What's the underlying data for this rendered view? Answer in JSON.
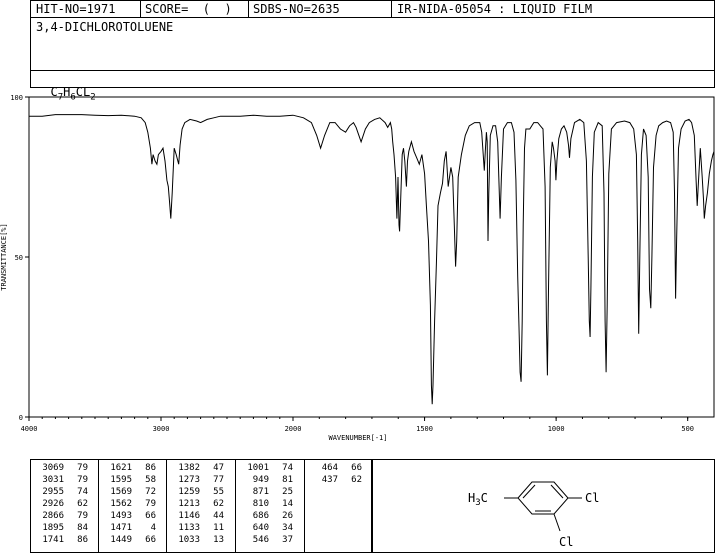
{
  "header": {
    "hit_no": "HIT-NO=1971",
    "score": "SCORE=  (  )",
    "sdbs_no": "SDBS-NO=2635",
    "ir_nida": "IR-NIDA-05054 : LIQUID FILM",
    "compound_name": "3,4-DICHLOROTOLUENE",
    "formula": {
      "c": "C",
      "c_sub": "7",
      "h": "H",
      "h_sub": "6",
      "cl": "CL",
      "cl_sub": "2"
    }
  },
  "chart_data": {
    "type": "line",
    "title": "",
    "xlabel": "WAVENUMBER[-1]",
    "ylabel": "TRANSMITTANCE[%]",
    "xlim": [
      4000,
      400
    ],
    "ylim": [
      0,
      100
    ],
    "x_ticks": [
      "4000",
      "3000",
      "2000",
      "1500",
      "1000",
      "500"
    ],
    "y_ticks": [
      "100",
      "50",
      "0"
    ],
    "grid": false,
    "series": [
      {
        "points": [
          [
            4000,
            94
          ],
          [
            3900,
            94
          ],
          [
            3800,
            94.5
          ],
          [
            3700,
            94.5
          ],
          [
            3600,
            94.5
          ],
          [
            3500,
            94.3
          ],
          [
            3400,
            94.2
          ],
          [
            3300,
            94.3
          ],
          [
            3200,
            94
          ],
          [
            3150,
            93.5
          ],
          [
            3120,
            92
          ],
          [
            3100,
            89
          ],
          [
            3080,
            84
          ],
          [
            3069,
            79
          ],
          [
            3060,
            82
          ],
          [
            3045,
            80
          ],
          [
            3031,
            79
          ],
          [
            3020,
            82
          ],
          [
            3000,
            83
          ],
          [
            2985,
            84
          ],
          [
            2970,
            80
          ],
          [
            2955,
            74
          ],
          [
            2945,
            72
          ],
          [
            2935,
            67
          ],
          [
            2926,
            62
          ],
          [
            2915,
            70
          ],
          [
            2900,
            84
          ],
          [
            2885,
            82
          ],
          [
            2866,
            79
          ],
          [
            2855,
            85
          ],
          [
            2840,
            90
          ],
          [
            2820,
            92
          ],
          [
            2780,
            93
          ],
          [
            2730,
            92.5
          ],
          [
            2700,
            92
          ],
          [
            2650,
            93
          ],
          [
            2600,
            93.5
          ],
          [
            2550,
            94
          ],
          [
            2500,
            94
          ],
          [
            2400,
            94
          ],
          [
            2300,
            94.3
          ],
          [
            2200,
            94
          ],
          [
            2100,
            94
          ],
          [
            2000,
            94.3
          ],
          [
            1960,
            93.5
          ],
          [
            1930,
            92
          ],
          [
            1910,
            88
          ],
          [
            1895,
            84
          ],
          [
            1880,
            88
          ],
          [
            1860,
            92
          ],
          [
            1840,
            92
          ],
          [
            1820,
            90
          ],
          [
            1800,
            89
          ],
          [
            1785,
            91
          ],
          [
            1770,
            92
          ],
          [
            1760,
            90.5
          ],
          [
            1741,
            86
          ],
          [
            1725,
            90
          ],
          [
            1710,
            92
          ],
          [
            1690,
            93
          ],
          [
            1670,
            93.5
          ],
          [
            1650,
            92
          ],
          [
            1640,
            90.5
          ],
          [
            1630,
            92
          ],
          [
            1625,
            90
          ],
          [
            1621,
            86
          ],
          [
            1616,
            82
          ],
          [
            1610,
            75
          ],
          [
            1605,
            62
          ],
          [
            1601,
            75
          ],
          [
            1597,
            60
          ],
          [
            1595,
            58
          ],
          [
            1590,
            70
          ],
          [
            1585,
            82
          ],
          [
            1580,
            84
          ],
          [
            1575,
            80
          ],
          [
            1569,
            72
          ],
          [
            1565,
            80
          ],
          [
            1560,
            83
          ],
          [
            1550,
            86
          ],
          [
            1540,
            83
          ],
          [
            1530,
            81
          ],
          [
            1520,
            79
          ],
          [
            1510,
            82
          ],
          [
            1500,
            76
          ],
          [
            1493,
            66
          ],
          [
            1485,
            55
          ],
          [
            1478,
            35
          ],
          [
            1474,
            10
          ],
          [
            1471,
            4
          ],
          [
            1468,
            10
          ],
          [
            1462,
            30
          ],
          [
            1455,
            48
          ],
          [
            1449,
            66
          ],
          [
            1440,
            70
          ],
          [
            1432,
            73
          ],
          [
            1425,
            80
          ],
          [
            1418,
            83
          ],
          [
            1410,
            72
          ],
          [
            1400,
            78
          ],
          [
            1393,
            75
          ],
          [
            1387,
            60
          ],
          [
            1382,
            47
          ],
          [
            1378,
            55
          ],
          [
            1372,
            75
          ],
          [
            1360,
            82
          ],
          [
            1345,
            88
          ],
          [
            1330,
            91
          ],
          [
            1310,
            92
          ],
          [
            1290,
            92
          ],
          [
            1283,
            89
          ],
          [
            1278,
            83
          ],
          [
            1273,
            77
          ],
          [
            1269,
            83
          ],
          [
            1265,
            89
          ],
          [
            1262,
            86
          ],
          [
            1259,
            55
          ],
          [
            1256,
            70
          ],
          [
            1250,
            88
          ],
          [
            1240,
            91
          ],
          [
            1230,
            91
          ],
          [
            1222,
            86
          ],
          [
            1218,
            75
          ],
          [
            1213,
            62
          ],
          [
            1208,
            75
          ],
          [
            1200,
            90
          ],
          [
            1185,
            92
          ],
          [
            1170,
            92
          ],
          [
            1160,
            89
          ],
          [
            1153,
            74
          ],
          [
            1146,
            44
          ],
          [
            1141,
            28
          ],
          [
            1137,
            14
          ],
          [
            1133,
            11
          ],
          [
            1129,
            30
          ],
          [
            1125,
            60
          ],
          [
            1120,
            84
          ],
          [
            1115,
            90
          ],
          [
            1100,
            90
          ],
          [
            1085,
            92
          ],
          [
            1070,
            92
          ],
          [
            1060,
            91
          ],
          [
            1050,
            90
          ],
          [
            1042,
            72
          ],
          [
            1037,
            30
          ],
          [
            1033,
            13
          ],
          [
            1029,
            40
          ],
          [
            1022,
            78
          ],
          [
            1015,
            86
          ],
          [
            1010,
            84
          ],
          [
            1004,
            80
          ],
          [
            1001,
            74
          ],
          [
            997,
            80
          ],
          [
            990,
            87
          ],
          [
            980,
            90
          ],
          [
            970,
            91
          ],
          [
            960,
            89
          ],
          [
            953,
            85
          ],
          [
            949,
            81
          ],
          [
            944,
            87
          ],
          [
            930,
            92
          ],
          [
            910,
            93
          ],
          [
            895,
            92
          ],
          [
            885,
            80
          ],
          [
            878,
            50
          ],
          [
            874,
            30
          ],
          [
            871,
            25
          ],
          [
            868,
            40
          ],
          [
            862,
            75
          ],
          [
            855,
            89
          ],
          [
            840,
            92
          ],
          [
            825,
            91
          ],
          [
            818,
            70
          ],
          [
            814,
            30
          ],
          [
            810,
            14
          ],
          [
            806,
            35
          ],
          [
            800,
            76
          ],
          [
            790,
            90
          ],
          [
            770,
            92
          ],
          [
            740,
            92.5
          ],
          [
            720,
            92
          ],
          [
            705,
            90
          ],
          [
            695,
            82
          ],
          [
            690,
            55
          ],
          [
            686,
            26
          ],
          [
            682,
            50
          ],
          [
            676,
            82
          ],
          [
            668,
            90
          ],
          [
            658,
            88
          ],
          [
            650,
            75
          ],
          [
            645,
            40
          ],
          [
            640,
            34
          ],
          [
            636,
            50
          ],
          [
            630,
            78
          ],
          [
            620,
            88
          ],
          [
            610,
            91
          ],
          [
            595,
            92
          ],
          [
            580,
            92.5
          ],
          [
            565,
            92
          ],
          [
            555,
            89
          ],
          [
            550,
            70
          ],
          [
            546,
            37
          ],
          [
            542,
            55
          ],
          [
            535,
            84
          ],
          [
            525,
            90
          ],
          [
            510,
            92.5
          ],
          [
            495,
            93
          ],
          [
            485,
            92
          ],
          [
            475,
            88
          ],
          [
            468,
            74
          ],
          [
            464,
            66
          ],
          [
            460,
            72
          ],
          [
            452,
            84
          ],
          [
            445,
            75
          ],
          [
            440,
            68
          ],
          [
            437,
            62
          ],
          [
            432,
            66
          ],
          [
            425,
            70
          ],
          [
            418,
            76
          ],
          [
            410,
            80
          ],
          [
            404,
            82
          ],
          [
            400,
            83
          ]
        ]
      }
    ]
  },
  "peak_table": {
    "columns": [
      [
        [
          "3069",
          "79"
        ],
        [
          "3031",
          "79"
        ],
        [
          "2955",
          "74"
        ],
        [
          "2926",
          "62"
        ],
        [
          "2866",
          "79"
        ],
        [
          "1895",
          "84"
        ],
        [
          "1741",
          "86"
        ]
      ],
      [
        [
          "1621",
          "86"
        ],
        [
          "1595",
          "58"
        ],
        [
          "1569",
          "72"
        ],
        [
          "1562",
          "79"
        ],
        [
          "1493",
          "66"
        ],
        [
          "1471",
          "4"
        ],
        [
          "1449",
          "66"
        ]
      ],
      [
        [
          "1382",
          "47"
        ],
        [
          "1273",
          "77"
        ],
        [
          "1259",
          "55"
        ],
        [
          "1213",
          "62"
        ],
        [
          "1146",
          "44"
        ],
        [
          "1133",
          "11"
        ],
        [
          "1033",
          "13"
        ]
      ],
      [
        [
          "1001",
          "74"
        ],
        [
          "949",
          "81"
        ],
        [
          "871",
          "25"
        ],
        [
          "810",
          "14"
        ],
        [
          "686",
          "26"
        ],
        [
          "640",
          "34"
        ],
        [
          "546",
          "37"
        ]
      ],
      [
        [
          "464",
          "66"
        ],
        [
          "437",
          "62"
        ]
      ]
    ]
  },
  "structure": {
    "methyl_label": "H3C",
    "methyl_h": "H",
    "methyl_sub": "3",
    "methyl_c": "C",
    "cl_top": "Cl",
    "cl_bottom": "Cl"
  }
}
